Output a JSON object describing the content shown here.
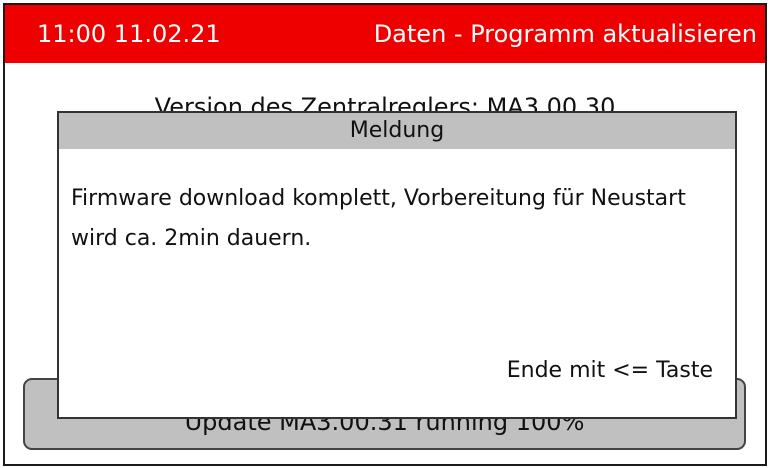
{
  "header": {
    "datetime": "11:00 11.02.21",
    "title": "Daten - Programm aktualisieren"
  },
  "background": {
    "version_text": "Version des Zentralreglers: MA3.00.30",
    "progress_text": "Update MA3.00.31 running 100%",
    "progress_percent": 100
  },
  "dialog": {
    "title": "Meldung",
    "message": "Firmware download komplett, Vorbereitung für Neustart wird ca. 2min dauern.",
    "hint": "Ende mit <= Taste"
  },
  "colors": {
    "header_bg": "#ee0000",
    "dialog_title_bg": "#c0c0c0",
    "progress_bg": "#c0c0c0"
  }
}
